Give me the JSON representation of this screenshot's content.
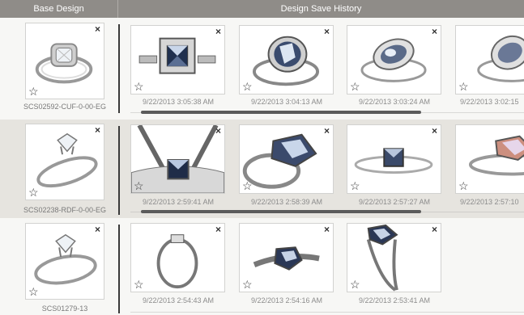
{
  "header": {
    "base_title": "Base Design",
    "history_title": "Design Save History"
  },
  "icons": {
    "close": "×",
    "star": "☆"
  },
  "rows": [
    {
      "sku": "SCS02592-CUF-0-00-EG",
      "history": [
        "9/22/2013 3:05:38 AM",
        "9/22/2013 3:04:13 AM",
        "9/22/2013 3:03:24 AM",
        "9/22/2013 3:02:15"
      ]
    },
    {
      "sku": "SCS02238-RDF-0-00-EG",
      "history": [
        "9/22/2013 2:59:41 AM",
        "9/22/2013 2:58:39 AM",
        "9/22/2013 2:57:27 AM",
        "9/22/2013 2:57:10"
      ]
    },
    {
      "sku": "SCS01279-13",
      "history": [
        "9/22/2013 2:54:43 AM",
        "9/22/2013 2:54:16 AM",
        "9/22/2013 2:53:41 AM"
      ]
    }
  ]
}
